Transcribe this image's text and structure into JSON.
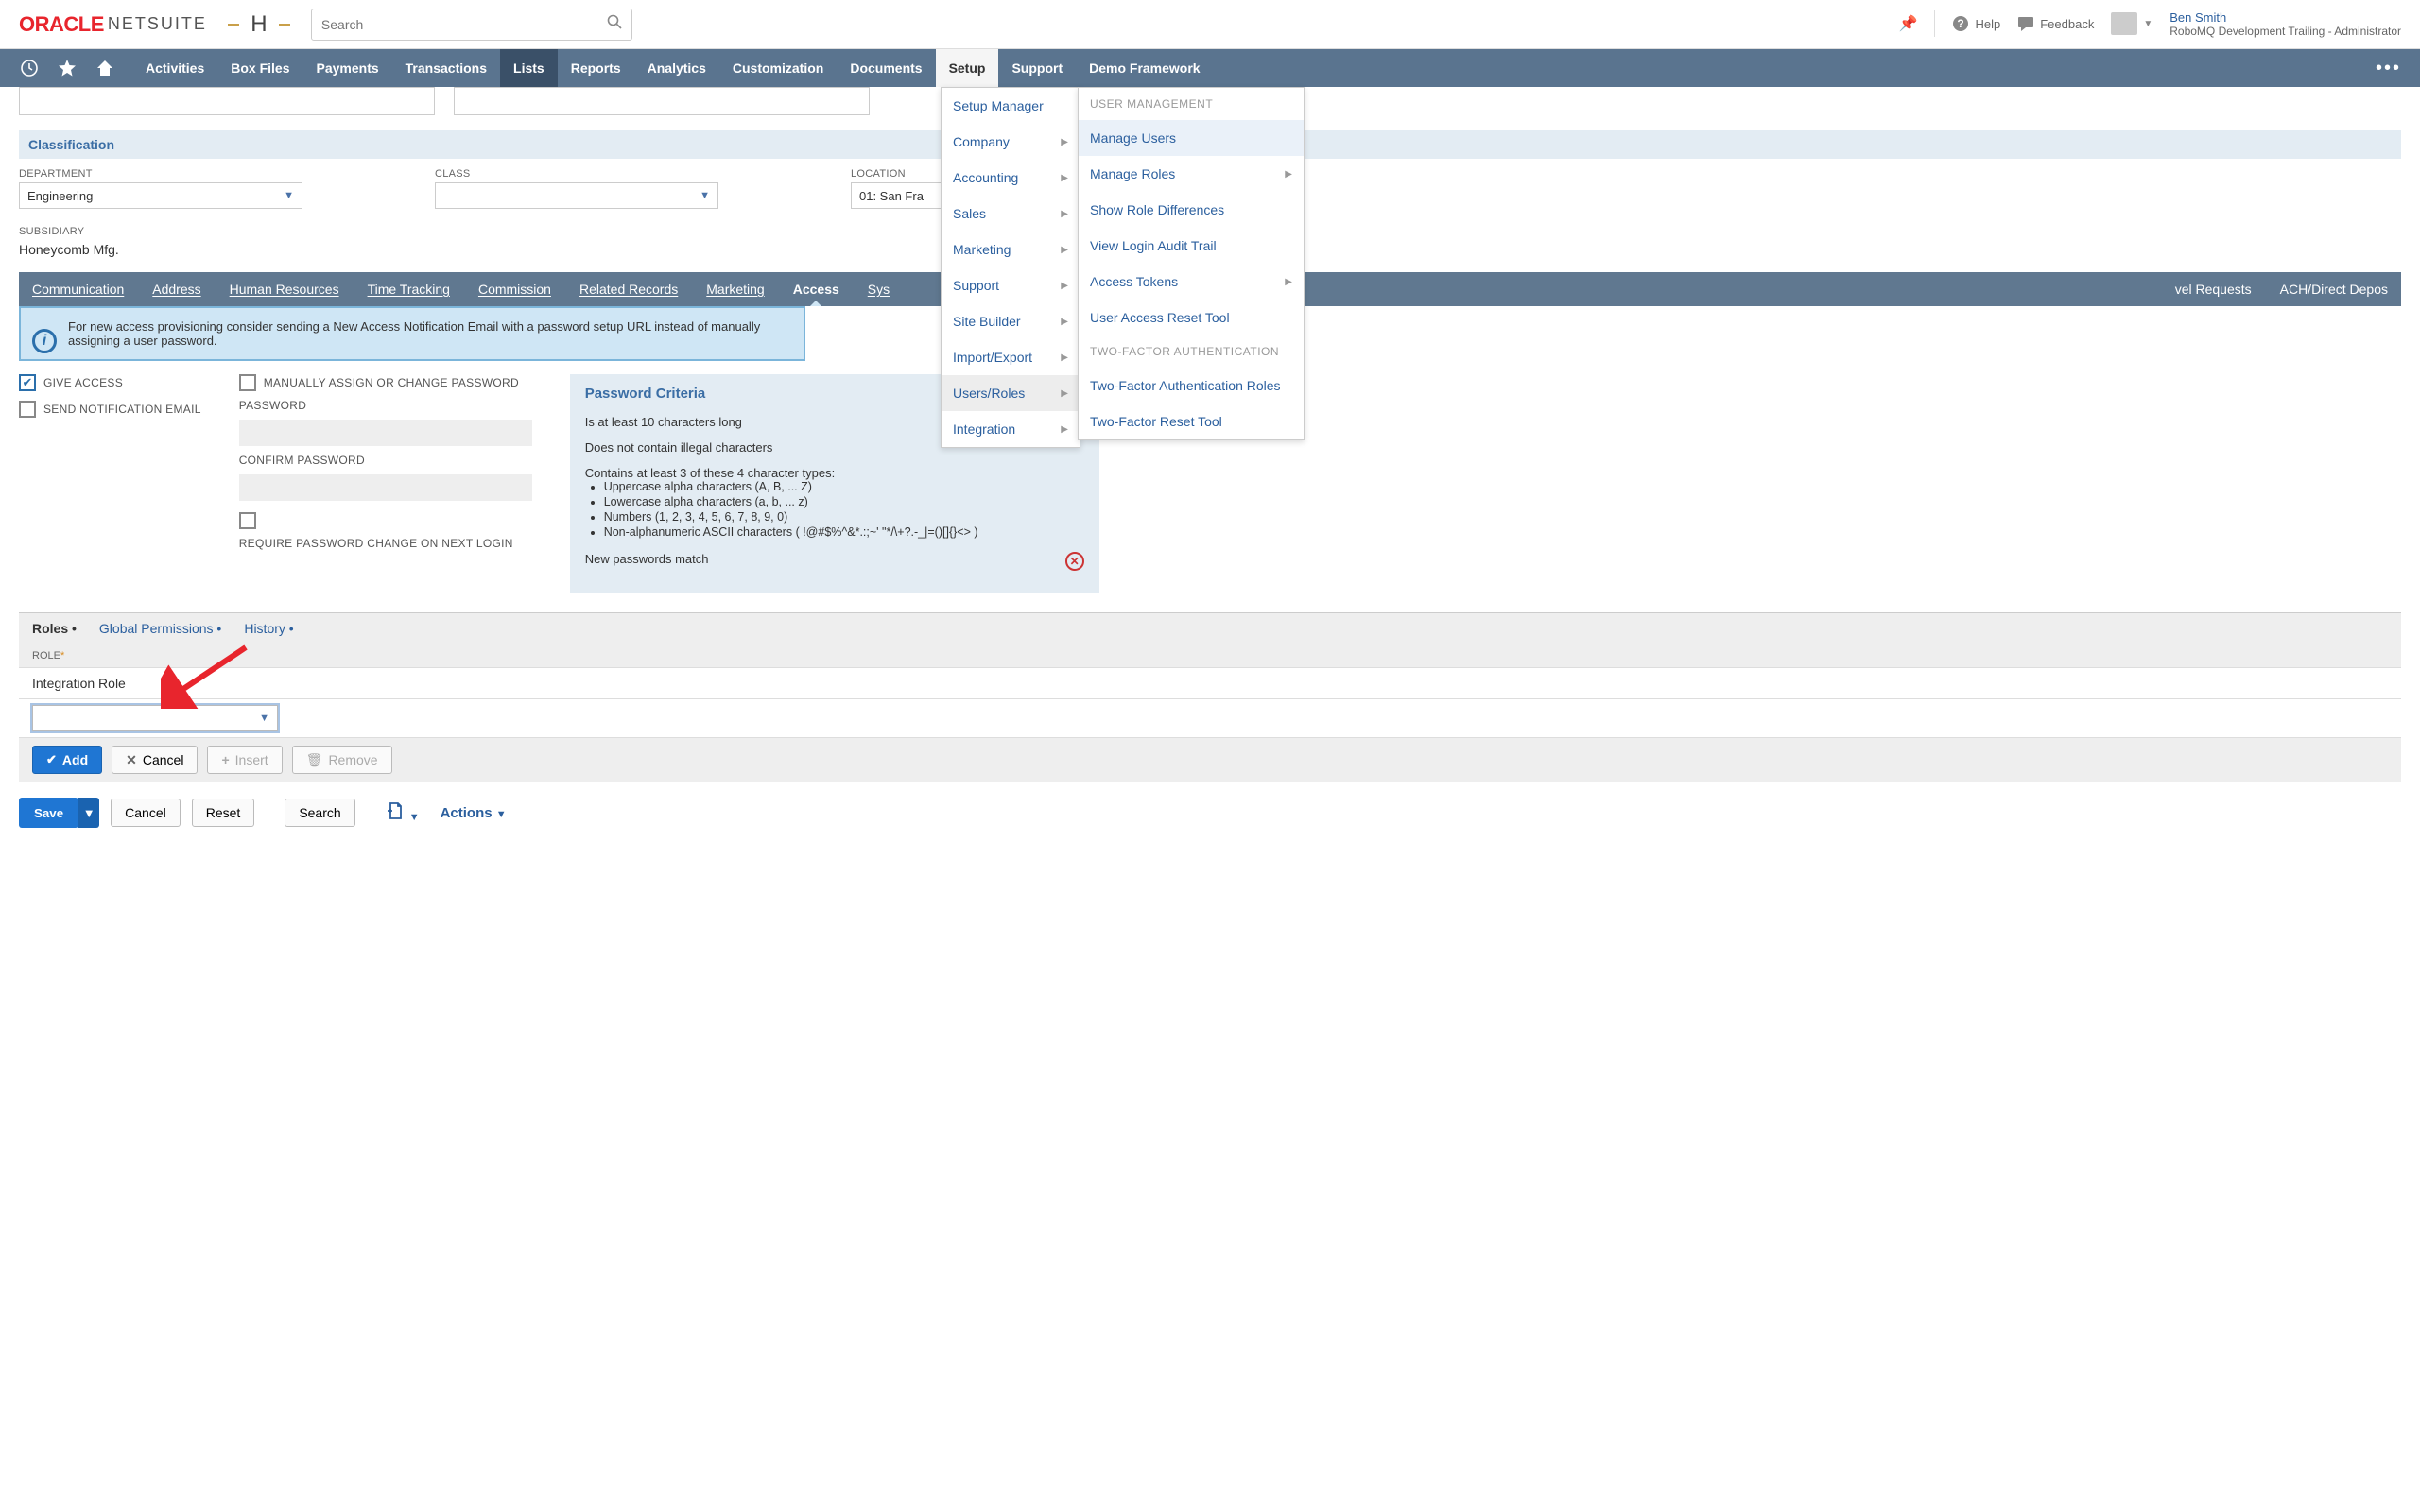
{
  "header": {
    "logo_oracle": "ORACLE",
    "logo_netsuite": "NETSUITE",
    "search_placeholder": "Search",
    "help": "Help",
    "feedback": "Feedback",
    "user_name": "Ben Smith",
    "user_role": "RoboMQ Development Trailing - Administrator"
  },
  "nav": {
    "items": [
      "Activities",
      "Box Files",
      "Payments",
      "Transactions",
      "Lists",
      "Reports",
      "Analytics",
      "Customization",
      "Documents",
      "Setup",
      "Support",
      "Demo Framework"
    ]
  },
  "setup_menu": {
    "items": [
      "Setup Manager",
      "Company",
      "Accounting",
      "Sales",
      "Marketing",
      "Support",
      "Site Builder",
      "Import/Export",
      "Users/Roles",
      "Integration"
    ]
  },
  "submenu": {
    "header1": "USER MANAGEMENT",
    "items1": [
      "Manage Users",
      "Manage Roles",
      "Show Role Differences",
      "View Login Audit Trail",
      "Access Tokens",
      "User Access Reset Tool"
    ],
    "header2": "TWO-FACTOR AUTHENTICATION",
    "items2": [
      "Two-Factor Authentication Roles",
      "Two-Factor Reset Tool"
    ]
  },
  "classification": {
    "heading": "Classification",
    "dept_label": "DEPARTMENT",
    "dept_value": "Engineering",
    "class_label": "CLASS",
    "class_value": "",
    "loc_label": "LOCATION",
    "loc_value": "01: San Fra",
    "sub_label": "SUBSIDIARY",
    "sub_value": "Honeycomb Mfg."
  },
  "subtabs": [
    "Communication",
    "Address",
    "Human Resources",
    "Time Tracking",
    "Commission",
    "Related Records",
    "Marketing",
    "Access",
    "Sys",
    "vel Requests",
    "ACH/Direct Depos"
  ],
  "info_text": "For new access provisioning consider sending a New Access Notification Email with a password setup URL instead of manually assigning a user password.",
  "access": {
    "give": "GIVE ACCESS",
    "send_email": "SEND NOTIFICATION EMAIL",
    "manual": "MANUALLY ASSIGN OR CHANGE PASSWORD",
    "password": "PASSWORD",
    "confirm": "CONFIRM PASSWORD",
    "require": "REQUIRE PASSWORD CHANGE ON NEXT LOGIN"
  },
  "criteria": {
    "title": "Password Criteria",
    "l1": "Is at least 10 characters long",
    "l2": "Does not contain illegal characters",
    "l3": "Contains at least 3 of these 4 character types:",
    "b1": "Uppercase alpha characters (A, B, ... Z)",
    "b2": "Lowercase alpha characters (a, b, ... z)",
    "b3": "Numbers (1, 2, 3, 4, 5, 6, 7, 8, 9, 0)",
    "b4": "Non-alphanumeric ASCII characters ( !@#$%^&*.:;~' \"*/\\+?.-_|=()[]{}<> )",
    "l4": "New passwords match"
  },
  "roles": {
    "tabs": [
      "Roles",
      "Global Permissions",
      "History"
    ],
    "label": "ROLE",
    "value": "Integration Role",
    "add": "Add",
    "cancel": "Cancel",
    "insert": "Insert",
    "remove": "Remove"
  },
  "footer": {
    "save": "Save",
    "cancel": "Cancel",
    "reset": "Reset",
    "search": "Search",
    "actions": "Actions"
  }
}
